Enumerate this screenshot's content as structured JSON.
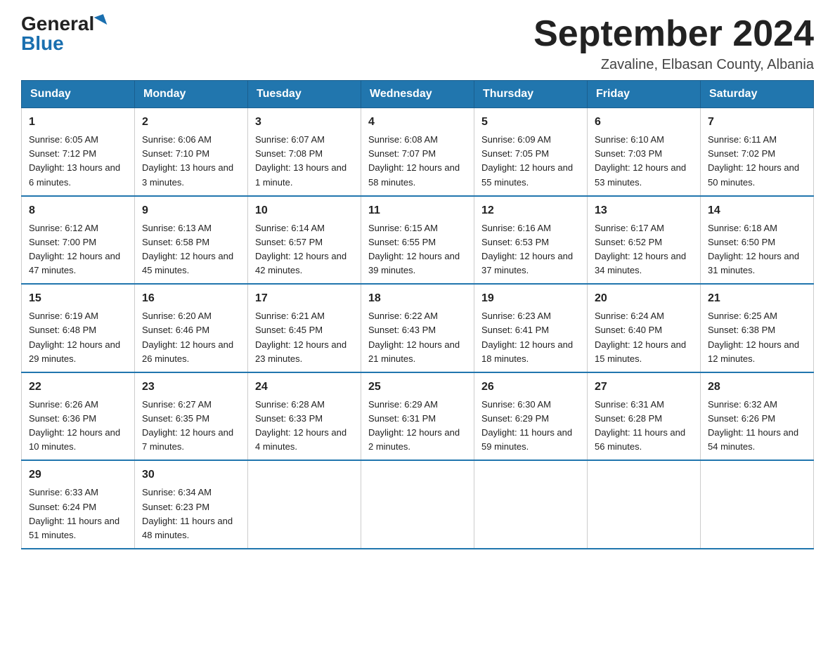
{
  "header": {
    "logo_general": "General",
    "logo_blue": "Blue",
    "month_title": "September 2024",
    "subtitle": "Zavaline, Elbasan County, Albania"
  },
  "weekdays": [
    "Sunday",
    "Monday",
    "Tuesday",
    "Wednesday",
    "Thursday",
    "Friday",
    "Saturday"
  ],
  "weeks": [
    [
      {
        "day": "1",
        "sunrise": "6:05 AM",
        "sunset": "7:12 PM",
        "daylight": "13 hours and 6 minutes."
      },
      {
        "day": "2",
        "sunrise": "6:06 AM",
        "sunset": "7:10 PM",
        "daylight": "13 hours and 3 minutes."
      },
      {
        "day": "3",
        "sunrise": "6:07 AM",
        "sunset": "7:08 PM",
        "daylight": "13 hours and 1 minute."
      },
      {
        "day": "4",
        "sunrise": "6:08 AM",
        "sunset": "7:07 PM",
        "daylight": "12 hours and 58 minutes."
      },
      {
        "day": "5",
        "sunrise": "6:09 AM",
        "sunset": "7:05 PM",
        "daylight": "12 hours and 55 minutes."
      },
      {
        "day": "6",
        "sunrise": "6:10 AM",
        "sunset": "7:03 PM",
        "daylight": "12 hours and 53 minutes."
      },
      {
        "day": "7",
        "sunrise": "6:11 AM",
        "sunset": "7:02 PM",
        "daylight": "12 hours and 50 minutes."
      }
    ],
    [
      {
        "day": "8",
        "sunrise": "6:12 AM",
        "sunset": "7:00 PM",
        "daylight": "12 hours and 47 minutes."
      },
      {
        "day": "9",
        "sunrise": "6:13 AM",
        "sunset": "6:58 PM",
        "daylight": "12 hours and 45 minutes."
      },
      {
        "day": "10",
        "sunrise": "6:14 AM",
        "sunset": "6:57 PM",
        "daylight": "12 hours and 42 minutes."
      },
      {
        "day": "11",
        "sunrise": "6:15 AM",
        "sunset": "6:55 PM",
        "daylight": "12 hours and 39 minutes."
      },
      {
        "day": "12",
        "sunrise": "6:16 AM",
        "sunset": "6:53 PM",
        "daylight": "12 hours and 37 minutes."
      },
      {
        "day": "13",
        "sunrise": "6:17 AM",
        "sunset": "6:52 PM",
        "daylight": "12 hours and 34 minutes."
      },
      {
        "day": "14",
        "sunrise": "6:18 AM",
        "sunset": "6:50 PM",
        "daylight": "12 hours and 31 minutes."
      }
    ],
    [
      {
        "day": "15",
        "sunrise": "6:19 AM",
        "sunset": "6:48 PM",
        "daylight": "12 hours and 29 minutes."
      },
      {
        "day": "16",
        "sunrise": "6:20 AM",
        "sunset": "6:46 PM",
        "daylight": "12 hours and 26 minutes."
      },
      {
        "day": "17",
        "sunrise": "6:21 AM",
        "sunset": "6:45 PM",
        "daylight": "12 hours and 23 minutes."
      },
      {
        "day": "18",
        "sunrise": "6:22 AM",
        "sunset": "6:43 PM",
        "daylight": "12 hours and 21 minutes."
      },
      {
        "day": "19",
        "sunrise": "6:23 AM",
        "sunset": "6:41 PM",
        "daylight": "12 hours and 18 minutes."
      },
      {
        "day": "20",
        "sunrise": "6:24 AM",
        "sunset": "6:40 PM",
        "daylight": "12 hours and 15 minutes."
      },
      {
        "day": "21",
        "sunrise": "6:25 AM",
        "sunset": "6:38 PM",
        "daylight": "12 hours and 12 minutes."
      }
    ],
    [
      {
        "day": "22",
        "sunrise": "6:26 AM",
        "sunset": "6:36 PM",
        "daylight": "12 hours and 10 minutes."
      },
      {
        "day": "23",
        "sunrise": "6:27 AM",
        "sunset": "6:35 PM",
        "daylight": "12 hours and 7 minutes."
      },
      {
        "day": "24",
        "sunrise": "6:28 AM",
        "sunset": "6:33 PM",
        "daylight": "12 hours and 4 minutes."
      },
      {
        "day": "25",
        "sunrise": "6:29 AM",
        "sunset": "6:31 PM",
        "daylight": "12 hours and 2 minutes."
      },
      {
        "day": "26",
        "sunrise": "6:30 AM",
        "sunset": "6:29 PM",
        "daylight": "11 hours and 59 minutes."
      },
      {
        "day": "27",
        "sunrise": "6:31 AM",
        "sunset": "6:28 PM",
        "daylight": "11 hours and 56 minutes."
      },
      {
        "day": "28",
        "sunrise": "6:32 AM",
        "sunset": "6:26 PM",
        "daylight": "11 hours and 54 minutes."
      }
    ],
    [
      {
        "day": "29",
        "sunrise": "6:33 AM",
        "sunset": "6:24 PM",
        "daylight": "11 hours and 51 minutes."
      },
      {
        "day": "30",
        "sunrise": "6:34 AM",
        "sunset": "6:23 PM",
        "daylight": "11 hours and 48 minutes."
      },
      null,
      null,
      null,
      null,
      null
    ]
  ]
}
